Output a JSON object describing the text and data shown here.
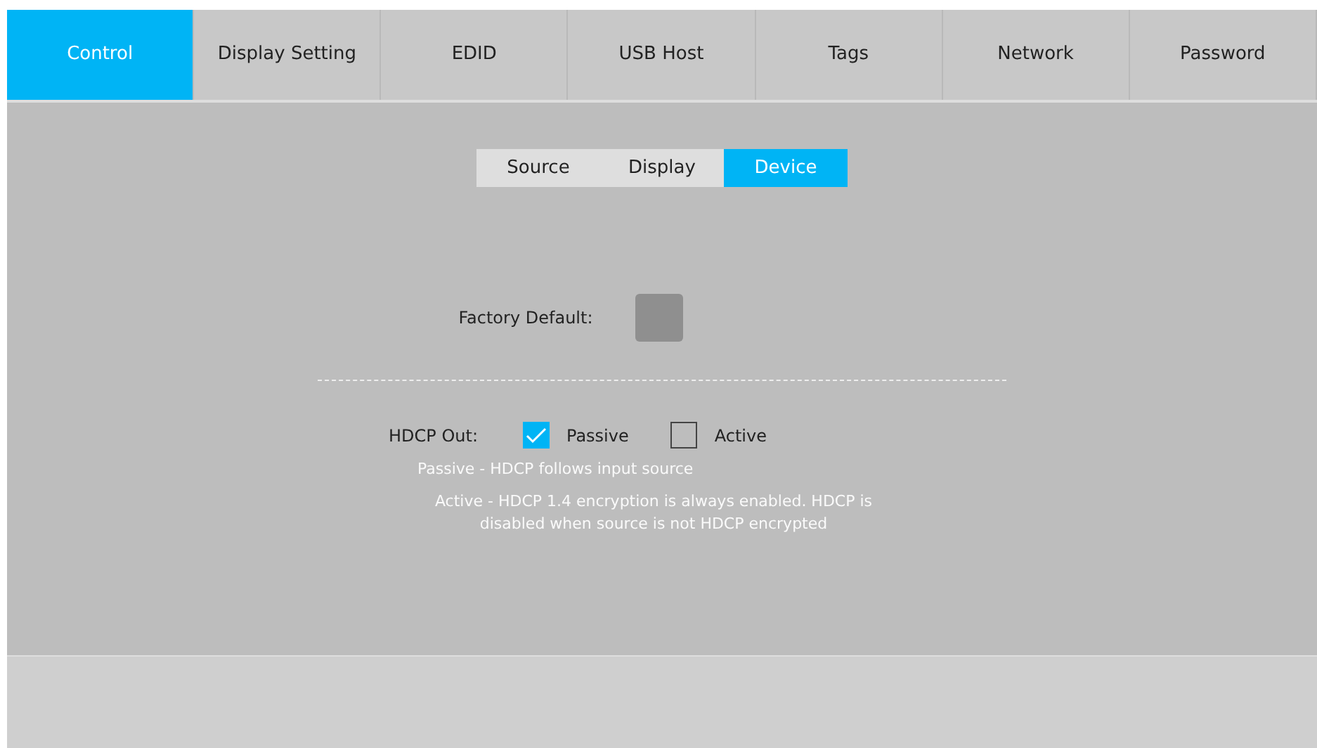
{
  "tabs": [
    {
      "label": "Control",
      "selected": true
    },
    {
      "label": "Display Setting",
      "selected": false
    },
    {
      "label": "EDID",
      "selected": false
    },
    {
      "label": "USB Host",
      "selected": false
    },
    {
      "label": "Tags",
      "selected": false
    },
    {
      "label": "Network",
      "selected": false
    },
    {
      "label": "Password",
      "selected": false
    }
  ],
  "subtabs": [
    {
      "label": "Source",
      "selected": false
    },
    {
      "label": "Display",
      "selected": false
    },
    {
      "label": "Device",
      "selected": true
    }
  ],
  "factory_default": {
    "label": "Factory Default:"
  },
  "hdcp_out": {
    "label": "HDCP Out:",
    "options": [
      {
        "label": "Passive",
        "checked": true
      },
      {
        "label": "Active",
        "checked": false
      }
    ],
    "help": [
      "Passive - HDCP follows input source",
      "Active - HDCP 1.4 encryption is always enabled. HDCP is disabled when source is not HDCP encrypted"
    ]
  }
}
